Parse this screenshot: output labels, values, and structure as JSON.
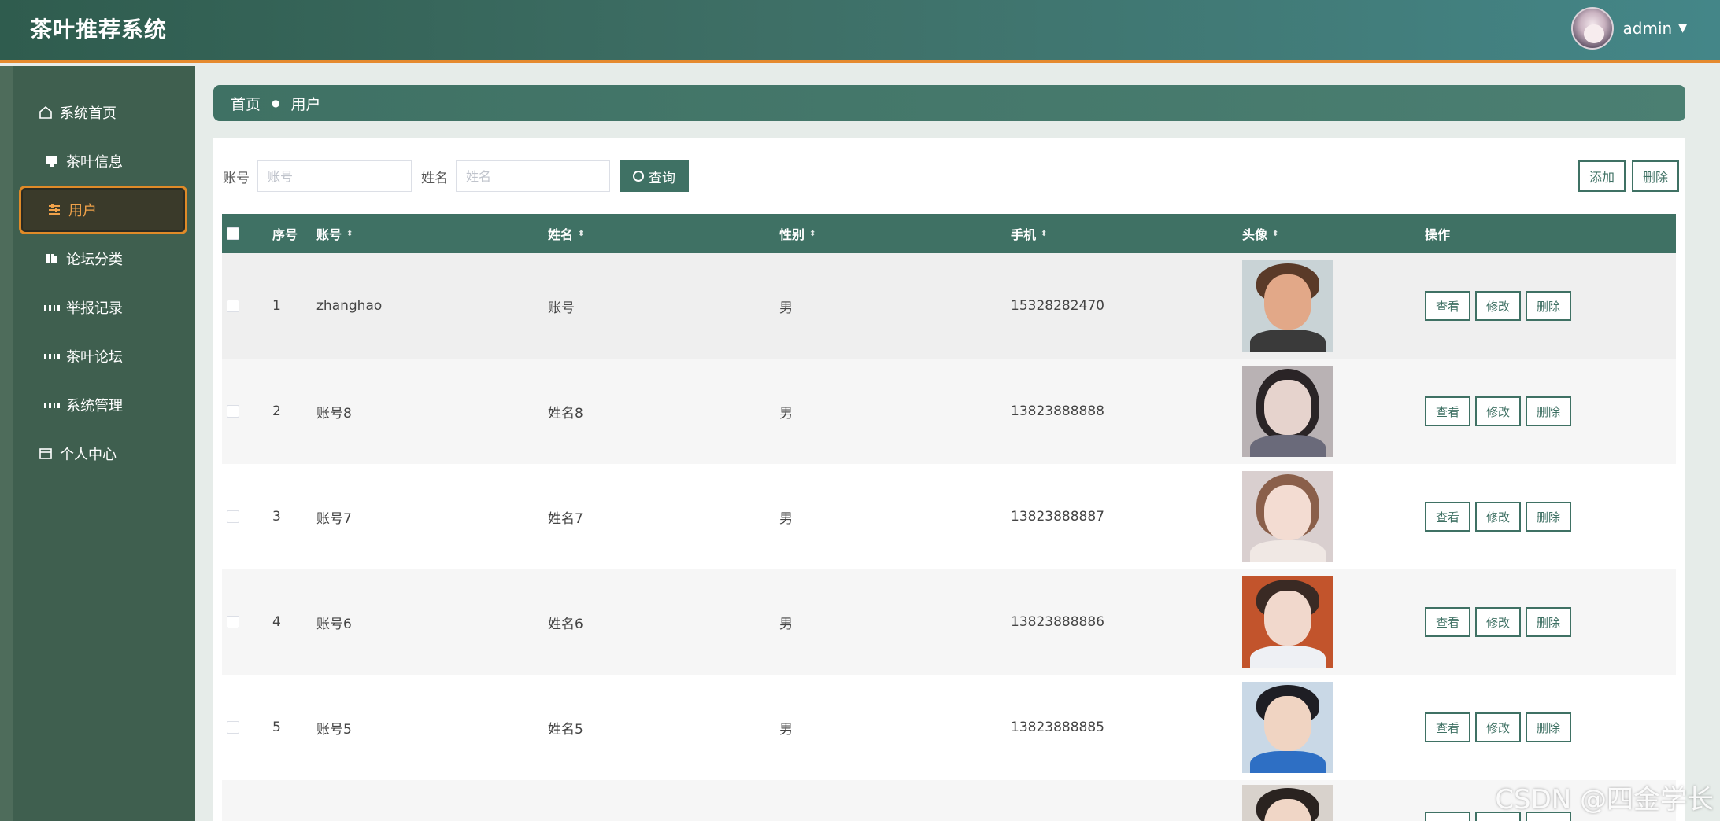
{
  "app": {
    "title": "茶叶推荐系统"
  },
  "user": {
    "name": "admin"
  },
  "sidebar": {
    "items": [
      {
        "label": "系统首页",
        "icon": "home-icon"
      },
      {
        "label": "茶叶信息",
        "icon": "monitor-icon"
      },
      {
        "label": "用户",
        "icon": "sliders-icon",
        "active": true
      },
      {
        "label": "论坛分类",
        "icon": "book-icon"
      },
      {
        "label": "举报记录",
        "icon": "grid-icon"
      },
      {
        "label": "茶叶论坛",
        "icon": "grid-icon"
      },
      {
        "label": "系统管理",
        "icon": "grid-icon"
      },
      {
        "label": "个人中心",
        "icon": "card-icon"
      }
    ]
  },
  "breadcrumb": {
    "home": "首页",
    "current": "用户"
  },
  "search": {
    "account_label": "账号",
    "account_placeholder": "账号",
    "name_label": "姓名",
    "name_placeholder": "姓名",
    "query_button": "查询",
    "add_button": "添加",
    "delete_button": "删除"
  },
  "table": {
    "columns": [
      "序号",
      "账号",
      "姓名",
      "性别",
      "手机",
      "头像",
      "操作"
    ],
    "rows": [
      {
        "index": "1",
        "account": "zhanghao",
        "name": "账号",
        "gender": "男",
        "phone": "15328282470"
      },
      {
        "index": "2",
        "account": "账号8",
        "name": "姓名8",
        "gender": "男",
        "phone": "13823888888"
      },
      {
        "index": "3",
        "account": "账号7",
        "name": "姓名7",
        "gender": "男",
        "phone": "13823888887"
      },
      {
        "index": "4",
        "account": "账号6",
        "name": "姓名6",
        "gender": "男",
        "phone": "13823888886"
      },
      {
        "index": "5",
        "account": "账号5",
        "name": "姓名5",
        "gender": "男",
        "phone": "13823888885"
      }
    ],
    "actions": {
      "view": "查看",
      "edit": "修改",
      "delete": "删除"
    }
  },
  "watermark": "CSDN @四金学长",
  "colors": {
    "primary": "#3f7164",
    "header_accent": "#e58a2f",
    "sidebar": "#3f5f4f"
  }
}
